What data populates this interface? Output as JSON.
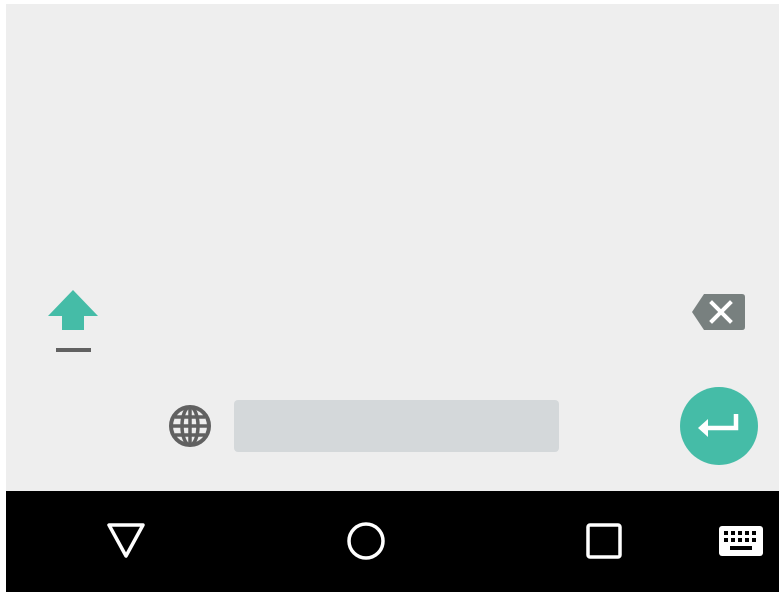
{
  "keyboard": {
    "shift": {
      "icon": "shift-arrow-up-icon",
      "active": true
    },
    "backspace": {
      "icon": "backspace-icon"
    },
    "language": {
      "icon": "globe-icon"
    },
    "spacebar": {
      "label": ""
    },
    "enter": {
      "icon": "enter-return-icon"
    }
  },
  "navbar": {
    "items": [
      {
        "icon": "back-triangle-icon"
      },
      {
        "icon": "home-circle-icon"
      },
      {
        "icon": "recents-square-icon"
      },
      {
        "icon": "keyboard-switcher-icon"
      }
    ]
  },
  "colors": {
    "accent": "#45bca7",
    "keyboard_bg": "#eeeeee",
    "spacebar": "#d4d8da",
    "icon_gray": "#616161",
    "navbar_bg": "#000000"
  }
}
